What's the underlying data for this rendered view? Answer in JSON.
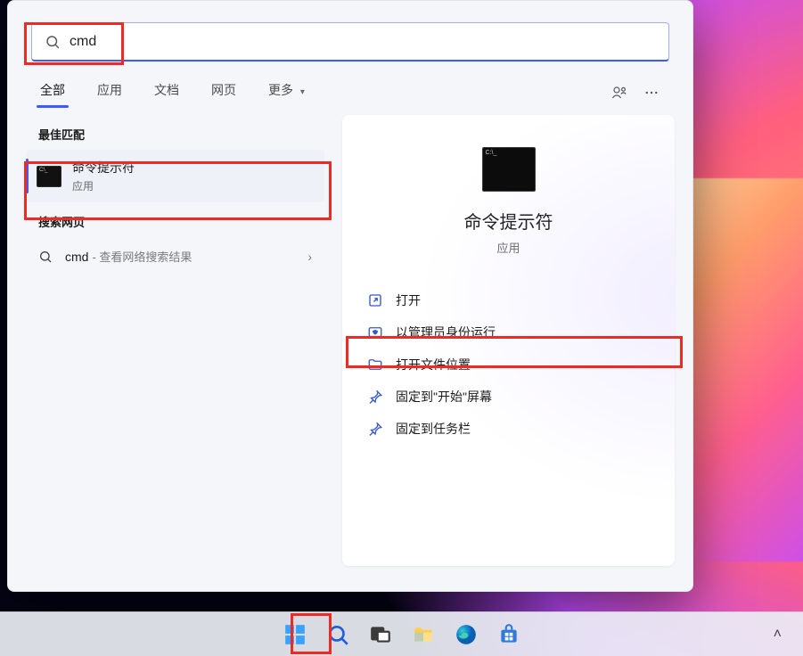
{
  "search": {
    "query": "cmd"
  },
  "tabs": {
    "items": [
      "全部",
      "应用",
      "文档",
      "网页",
      "更多"
    ],
    "active_index": 0
  },
  "left": {
    "best_match_header": "最佳匹配",
    "best_match": {
      "title": "命令提示符",
      "subtitle": "应用"
    },
    "web_header": "搜索网页",
    "web_item": {
      "term": "cmd",
      "suffix": " - 查看网络搜索结果"
    }
  },
  "right": {
    "title": "命令提示符",
    "subtitle": "应用",
    "actions": [
      {
        "key": "open",
        "label": "打开"
      },
      {
        "key": "run-admin",
        "label": "以管理员身份运行"
      },
      {
        "key": "open-loc",
        "label": "打开文件位置"
      },
      {
        "key": "pin-start",
        "label": "固定到\"开始\"屏幕"
      },
      {
        "key": "pin-taskbar",
        "label": "固定到任务栏"
      }
    ]
  },
  "taskbar": {
    "items": [
      "start",
      "search",
      "task-view",
      "file-explorer",
      "edge",
      "microsoft-store"
    ]
  }
}
